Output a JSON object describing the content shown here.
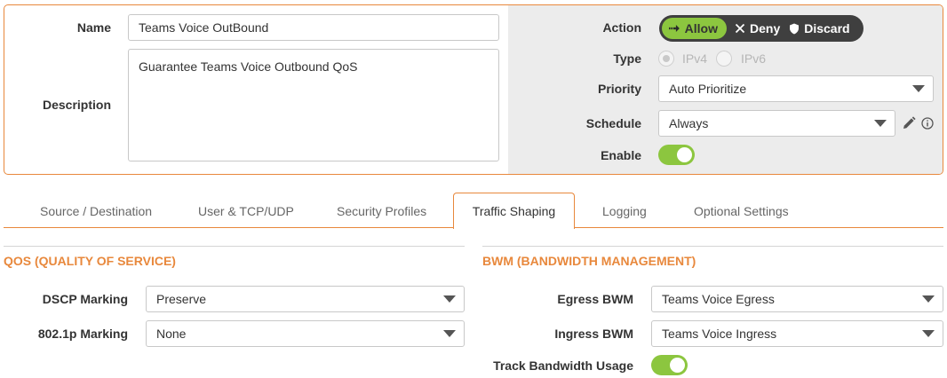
{
  "rule": {
    "name_label": "Name",
    "name_value": "Teams Voice OutBound",
    "description_label": "Description",
    "description_value": "Guarantee Teams Voice Outbound QoS",
    "action_label": "Action",
    "action_options": [
      "Allow",
      "Deny",
      "Discard"
    ],
    "action_selected": "Allow",
    "type_label": "Type",
    "type_options": [
      "IPv4",
      "IPv6"
    ],
    "type_selected": "IPv4",
    "priority_label": "Priority",
    "priority_value": "Auto Prioritize",
    "schedule_label": "Schedule",
    "schedule_value": "Always",
    "enable_label": "Enable",
    "enable_on": true
  },
  "tabs": [
    {
      "label": "Source / Destination"
    },
    {
      "label": "User & TCP/UDP"
    },
    {
      "label": "Security Profiles"
    },
    {
      "label": "Traffic Shaping",
      "active": true
    },
    {
      "label": "Logging"
    },
    {
      "label": "Optional Settings"
    }
  ],
  "qos": {
    "title": "QOS (QUALITY OF SERVICE)",
    "dscp_label": "DSCP Marking",
    "dscp_value": "Preserve",
    "p8021_label": "802.1p Marking",
    "p8021_value": "None"
  },
  "bwm": {
    "title": "BWM (BANDWIDTH MANAGEMENT)",
    "egress_label": "Egress BWM",
    "egress_value": "Teams Voice Egress",
    "ingress_label": "Ingress BWM",
    "ingress_value": "Teams Voice Ingress",
    "track_label": "Track Bandwidth Usage",
    "track_on": true
  },
  "icons": {
    "allow": "arrow-right-icon",
    "deny": "x-icon",
    "discard": "shield-icon",
    "edit": "pencil-icon",
    "info": "info-icon",
    "dropdown": "chevron-down-icon"
  },
  "colors": {
    "accent": "#e8883c",
    "toggle_on": "#8cc63f",
    "action_bg": "#3f3f3f"
  }
}
